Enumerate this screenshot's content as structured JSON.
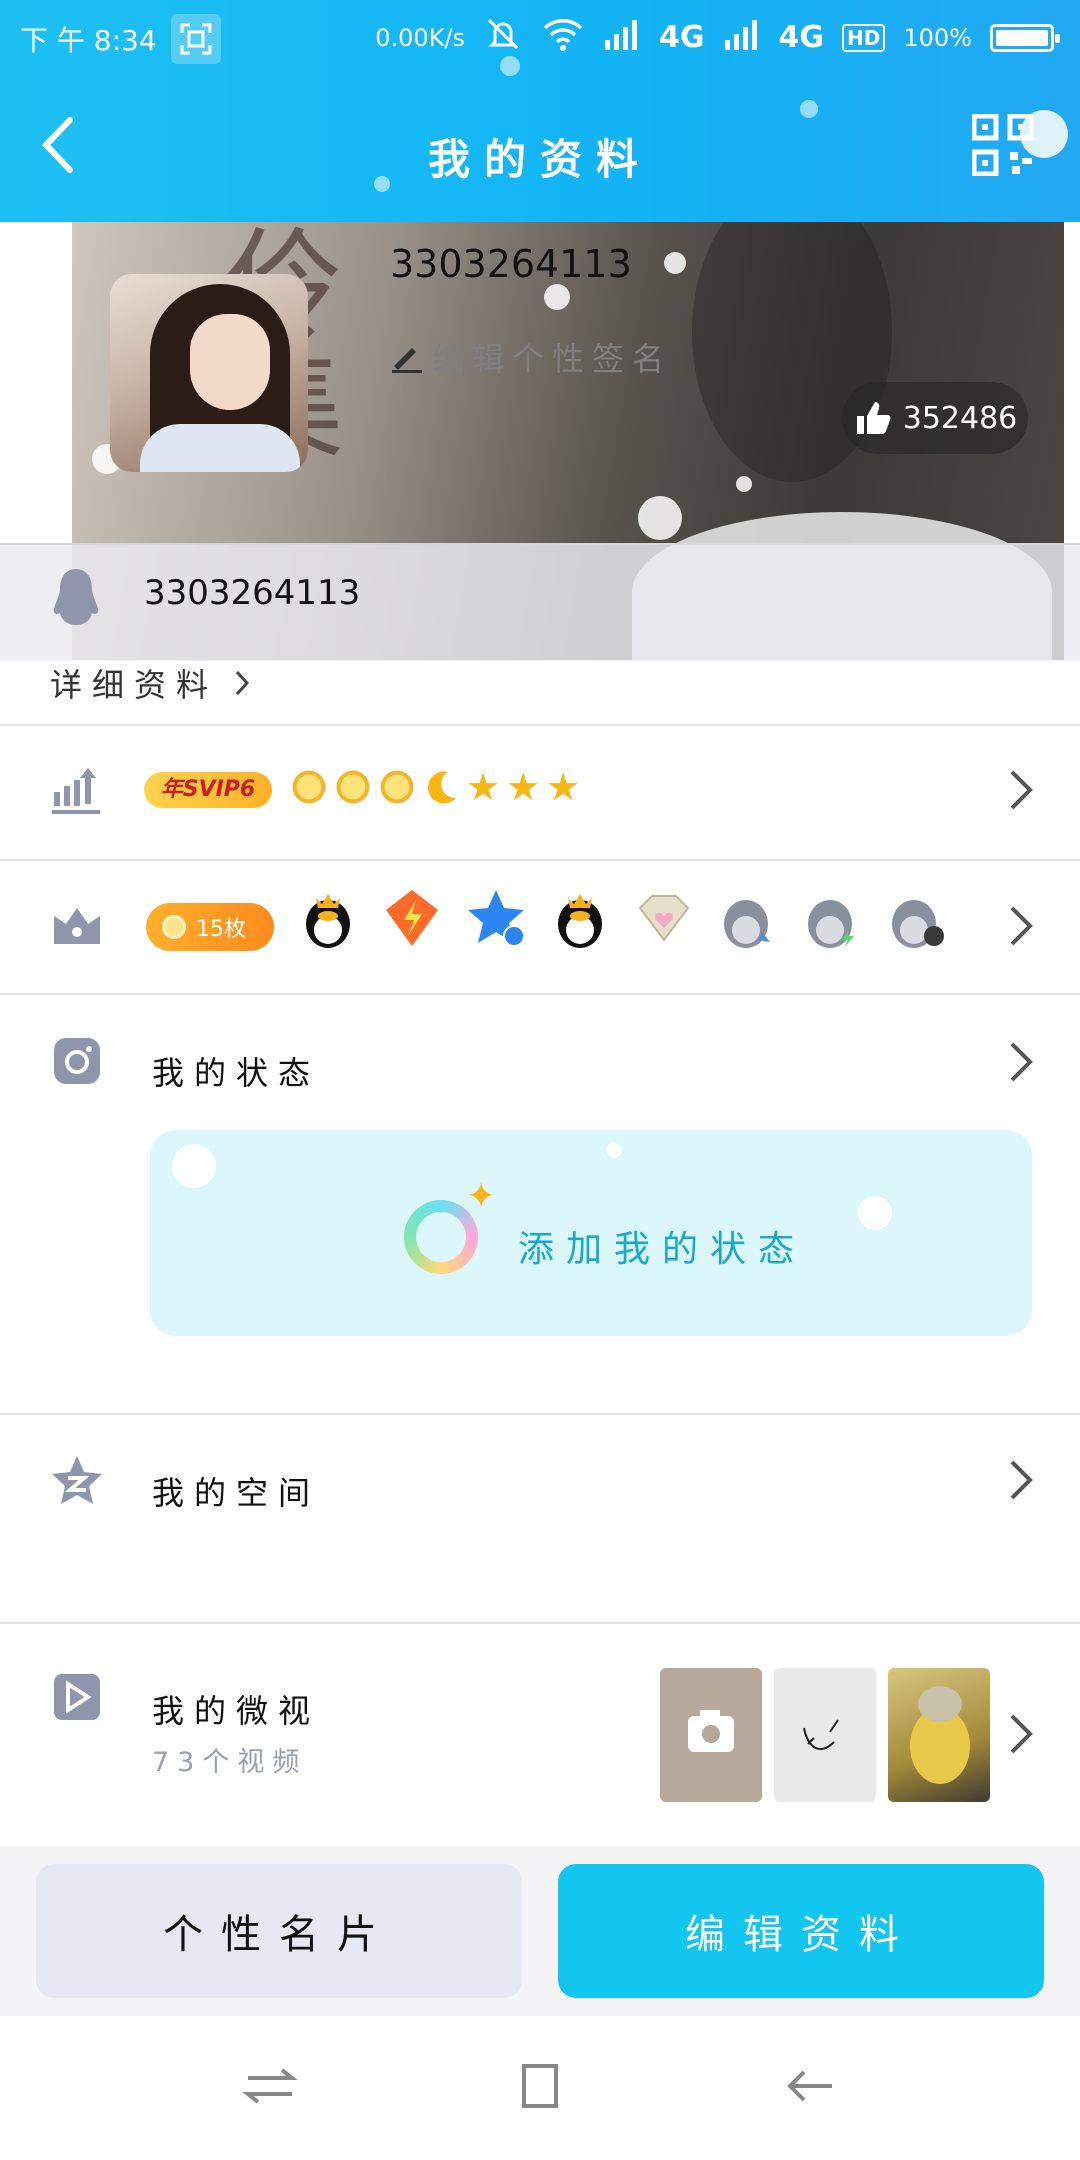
{
  "status_bar": {
    "time": "下 午 8:34",
    "speed": "0.00K/s",
    "network1": "4G",
    "network2": "4G",
    "hd": "HD",
    "battery": "100%"
  },
  "header": {
    "title": "我的资料",
    "icons": {
      "back": "back-arrow-icon",
      "qr": "qr-code-icon"
    }
  },
  "profile": {
    "name": "3303264113",
    "signature_placeholder": "编辑个性签名",
    "likes": "352486",
    "qq_number": "3303264113",
    "detail_link": "详细资料"
  },
  "rows": {
    "vip": {
      "badge": "年SVIP6"
    },
    "medals": {
      "badge": "15枚"
    },
    "status": {
      "title": "我的状态",
      "add_label": "添加我的状态"
    },
    "space": {
      "title": "我的空间"
    },
    "videos": {
      "title": "我的微视",
      "count_label": "73个视频"
    }
  },
  "actions": {
    "card_label": "个性名片",
    "edit_label": "编辑资料"
  },
  "colors": {
    "header": "#1ec0f4",
    "edit_button": "#12c6ef",
    "card_button": "#e6e8f4",
    "status_card": "#dcf7fb"
  }
}
